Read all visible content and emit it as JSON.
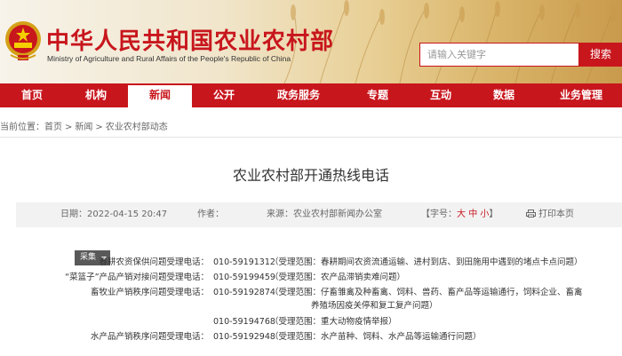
{
  "header": {
    "title_cn": "中华人民共和国农业农村部",
    "title_en": "Ministry of Agriculture and Rural Affairs of the People's Republic of China",
    "search_placeholder": "请输入关键字",
    "search_button": "搜索"
  },
  "nav": {
    "items": [
      {
        "label": "首页"
      },
      {
        "label": "机构"
      },
      {
        "label": "新闻",
        "active": true
      },
      {
        "label": "公开"
      },
      {
        "label": "政务服务"
      },
      {
        "label": "专题"
      },
      {
        "label": "互动"
      },
      {
        "label": "数据"
      },
      {
        "label": "业务管理"
      }
    ]
  },
  "breadcrumb": {
    "prefix": "当前位置：",
    "items": [
      "首页",
      "新闻",
      "农业农村部动态"
    ],
    "separator": ">"
  },
  "article": {
    "title": "农业农村部开通热线电话",
    "date_label": "日期：",
    "date": "2022-04-15 20:47",
    "author_label": "作者：",
    "author": "",
    "source_label": "来源：",
    "source": "农业农村部新闻办公室",
    "fontsize_prefix": "【字号：",
    "fontsize_large": "大",
    "fontsize_medium": "中",
    "fontsize_small": "小",
    "fontsize_suffix": "】",
    "print": "打印本页",
    "collect": "采集"
  },
  "hotlines": [
    {
      "label": "春耕农资保供问题受理电话：",
      "phone": "010-59191312",
      "scope": "（受理范围：春耕期间农资流通运输、进村到店、到田施用中遇到的堵点卡点问题）"
    },
    {
      "label": "“菜篮子”产品产销对接问题受理电话：",
      "phone": "010-59199459",
      "scope": "（受理范围：农产品滞销卖难问题）"
    },
    {
      "label": "畜牧业产销秩序问题受理电话：",
      "phone": "010-59192874",
      "scope": "（受理范围：仔畜雏禽及种畜禽、饲料、兽药、畜产品等运输通行，饲料企业、畜禽"
    },
    {
      "label": "",
      "phone": "",
      "scope": "养殖场因疫关停和复工复产问题）"
    },
    {
      "label": "",
      "phone": "010-59194768",
      "scope": "（受理范围：重大动物疫情举报）"
    },
    {
      "label": "水产品产销秩序问题受理电话：",
      "phone": "010-59192948",
      "scope": "（受理范围：水产苗种、饲料、水产品等运输通行问题）"
    }
  ]
}
